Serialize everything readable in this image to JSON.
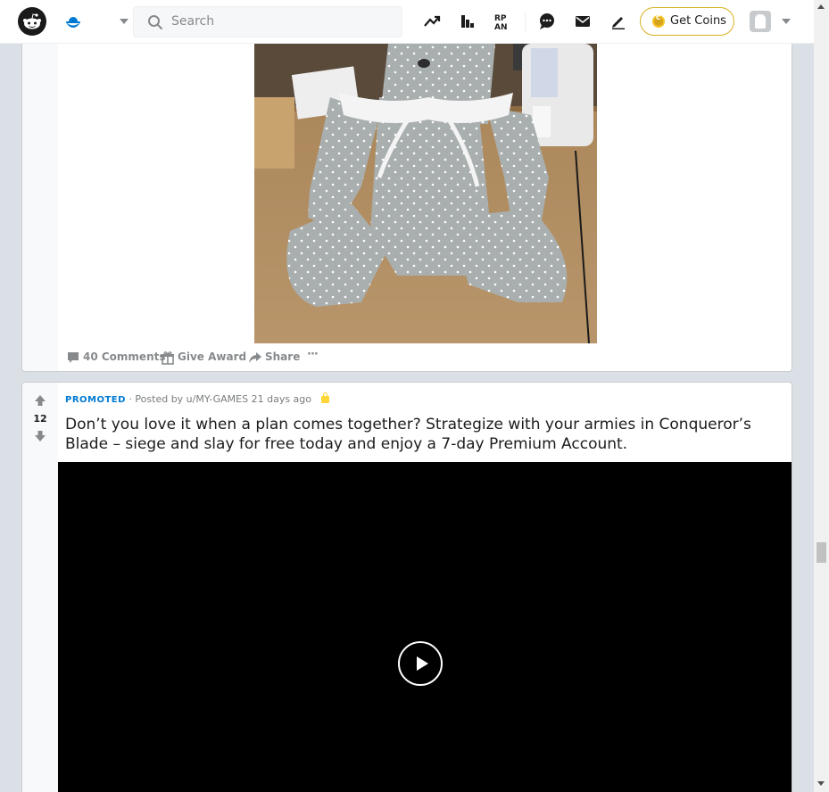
{
  "header": {
    "search_placeholder": "Search",
    "get_coins_label": "Get Coins",
    "icons": [
      "reddit-logo",
      "community-icon",
      "trending-icon",
      "leaderboard-icon",
      "rpan-icon",
      "chat-icon",
      "mail-icon",
      "create-post-icon"
    ]
  },
  "post1": {
    "actions": {
      "comments": "40 Comments",
      "award": "Give Award",
      "share": "Share",
      "more": "···"
    }
  },
  "post2": {
    "score": "12",
    "promoted": "PROMOTED",
    "posted_by": "· Posted by u/MY-GAMES 21 days ago",
    "title": "Don’t you love it when a plan comes together? Strategize with your armies in Conqueror’s Blade – siege and slay for free today and enjoy a 7-day Premium Account."
  },
  "colors": {
    "accent": "#0079d3",
    "coin_border": "#d7b11e",
    "page_bg": "#dae0e6"
  }
}
